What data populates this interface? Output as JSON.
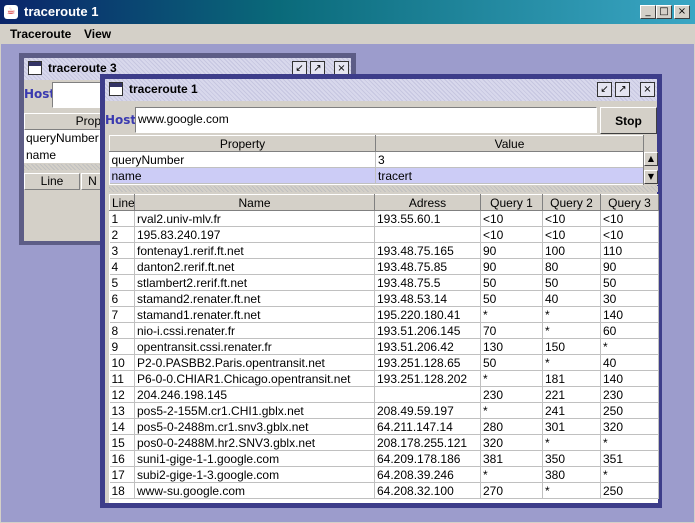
{
  "window": {
    "title": "traceroute 1",
    "app_icon": "java-cup-icon",
    "controls": [
      "_",
      "□",
      "×"
    ]
  },
  "menu": [
    {
      "label": "Traceroute"
    },
    {
      "label": "View"
    }
  ],
  "back_frame": {
    "title": "traceroute 3",
    "host_label": "Host:",
    "host_value": "",
    "prop_header": "Prop",
    "props": [
      "queryNumber",
      "name"
    ],
    "route_headers": [
      "Line",
      "N"
    ]
  },
  "front_frame": {
    "title": "traceroute 1",
    "host_label": "Host:",
    "host_value": "www.google.com",
    "stop_label": "Stop",
    "property_headers": [
      "Property",
      "Value"
    ],
    "properties": [
      {
        "property": "queryNumber",
        "value": "3"
      },
      {
        "property": "name",
        "value": "tracert"
      }
    ],
    "route_headers": [
      "Line",
      "Name",
      "Adress",
      "Query 1",
      "Query 2",
      "Query 3"
    ],
    "routes": [
      [
        "1",
        "rval2.univ-mlv.fr",
        "193.55.60.1",
        "<10",
        "<10",
        "<10"
      ],
      [
        "2",
        "195.83.240.197",
        "",
        "<10",
        "<10",
        "<10"
      ],
      [
        "3",
        "fontenay1.rerif.ft.net",
        "193.48.75.165",
        "90",
        "100",
        "110"
      ],
      [
        "4",
        "danton2.rerif.ft.net",
        "193.48.75.85",
        "90",
        "80",
        "90"
      ],
      [
        "5",
        "stlambert2.rerif.ft.net",
        "193.48.75.5",
        "50",
        "50",
        "50"
      ],
      [
        "6",
        "stamand2.renater.ft.net",
        "193.48.53.14",
        "50",
        "40",
        "30"
      ],
      [
        "7",
        "stamand1.renater.ft.net",
        "195.220.180.41",
        "*",
        "*",
        "140"
      ],
      [
        "8",
        "nio-i.cssi.renater.fr",
        "193.51.206.145",
        "70",
        "*",
        "60"
      ],
      [
        "9",
        "opentransit.cssi.renater.fr",
        "193.51.206.42",
        "130",
        "150",
        "*"
      ],
      [
        "10",
        "P2-0.PASBB2.Paris.opentransit.net",
        "193.251.128.65",
        "50",
        "*",
        "40"
      ],
      [
        "11",
        "P6-0-0.CHIAR1.Chicago.opentransit.net",
        "193.251.128.202",
        "*",
        "181",
        "140"
      ],
      [
        "12",
        "204.246.198.145",
        "",
        "230",
        "221",
        "230"
      ],
      [
        "13",
        "pos5-2-155M.cr1.CHI1.gblx.net",
        "208.49.59.197",
        "*",
        "241",
        "250"
      ],
      [
        "14",
        "pos5-0-2488m.cr1.snv3.gblx.net",
        "64.211.147.14",
        "280",
        "301",
        "320"
      ],
      [
        "15",
        "pos0-0-2488M.hr2.SNV3.gblx.net",
        "208.178.255.121",
        "320",
        "*",
        "*"
      ],
      [
        "16",
        "suni1-gige-1-1.google.com",
        "64.209.178.186",
        "381",
        "350",
        "351"
      ],
      [
        "17",
        "subi2-gige-1-3.google.com",
        "64.208.39.246",
        "*",
        "380",
        "*"
      ],
      [
        "18",
        "www-su.google.com",
        "64.208.32.100",
        "270",
        "*",
        "250"
      ]
    ]
  },
  "colors": {
    "desktop": "#9c9ccc",
    "selection": "#ccccf6",
    "host_label": "#3a3ab0"
  }
}
